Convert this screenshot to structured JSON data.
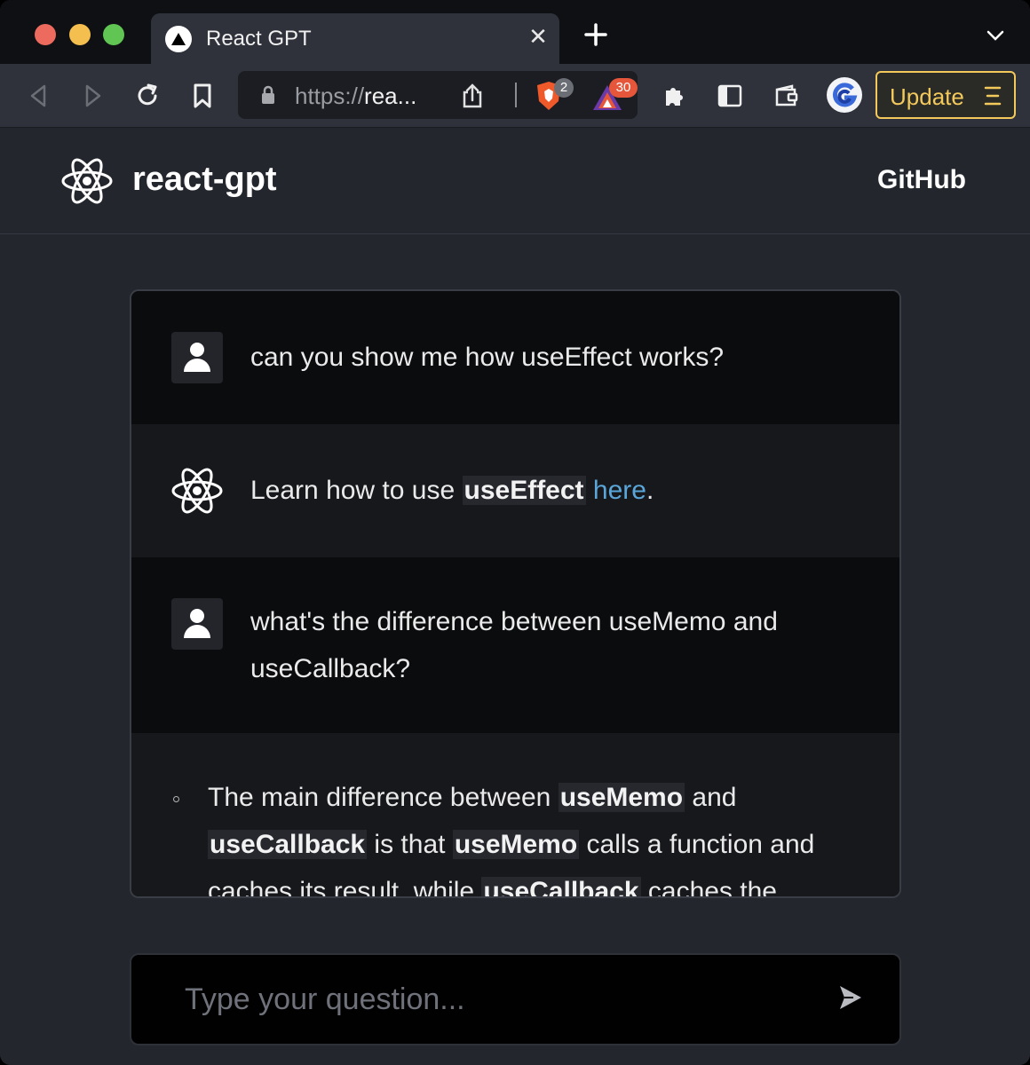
{
  "browser": {
    "tab": {
      "title": "React GPT",
      "close_glyph": "✕",
      "favicon": "triangle-logo-icon"
    },
    "url": {
      "scheme": "https://",
      "host_truncated": "rea..."
    },
    "shield_badge": "2",
    "rewards_badge": "30",
    "update_label": "Update",
    "colors": {
      "update_accent": "#f3c95c",
      "brave_orange": "#f05a2a",
      "badge_red": "#e5563a"
    }
  },
  "site": {
    "title": "react-gpt",
    "github_label": "GitHub",
    "logo": "react-atom-icon"
  },
  "messages": [
    {
      "role": "user",
      "text": "can you show me how useEffect works?"
    },
    {
      "role": "assistant",
      "parts": {
        "before": "Learn how to use ",
        "code": "useEffect",
        "space": " ",
        "link": "here",
        "after": "."
      }
    },
    {
      "role": "user",
      "text": "what's the difference between useMemo and useCallback?"
    },
    {
      "role": "assistant",
      "parts": {
        "t1": "The main difference between ",
        "c1": "useMemo",
        "t2": " and ",
        "c2": "useCallback",
        "t3": " is that ",
        "c3": "useMemo",
        "t4": " calls a function and caches its result, while ",
        "c4": "useCallback",
        "t5": " caches the"
      }
    }
  ],
  "composer": {
    "placeholder": "Type your question...",
    "send_icon": "send-arrow-icon"
  },
  "theme": {
    "link_color": "#5aa6d9",
    "page_bg": "#24262e",
    "user_msg_bg": "#0b0c0e"
  }
}
